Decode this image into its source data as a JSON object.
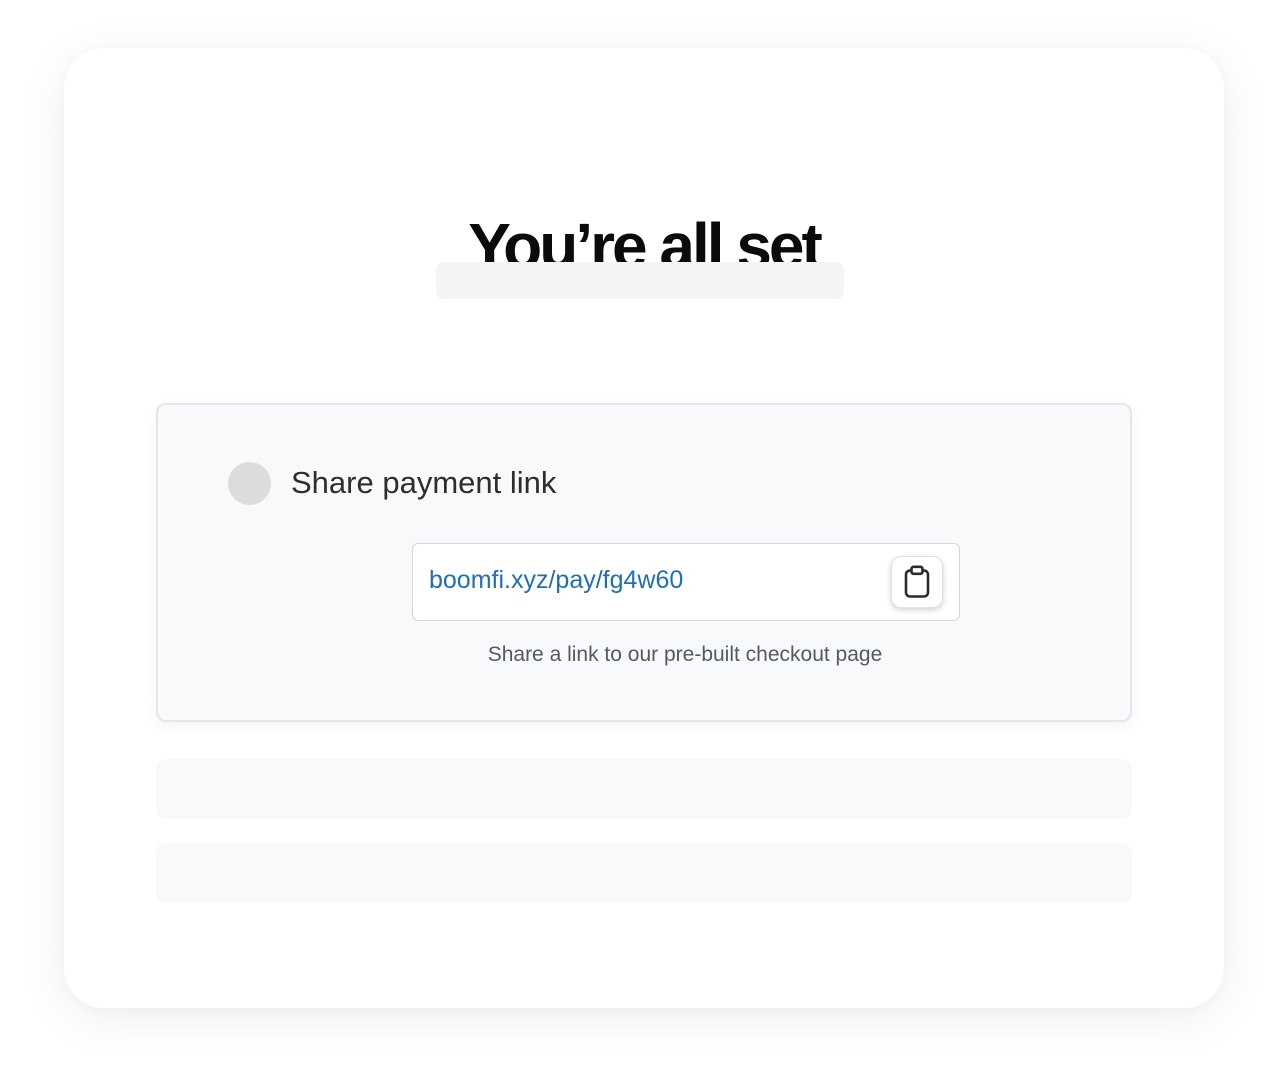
{
  "heading": {
    "title": "You’re all set"
  },
  "share_payment_link": {
    "title": "Share payment link",
    "link": "boomfi.xyz/pay/fg4w60",
    "hint": "Share a link to our pre-built checkout page",
    "copy_icon": "clipboard-icon"
  },
  "colors": {
    "link": "#1f6fb5",
    "panel_background": "#f8f9fb",
    "radio_dot": "#dcdcdc"
  }
}
